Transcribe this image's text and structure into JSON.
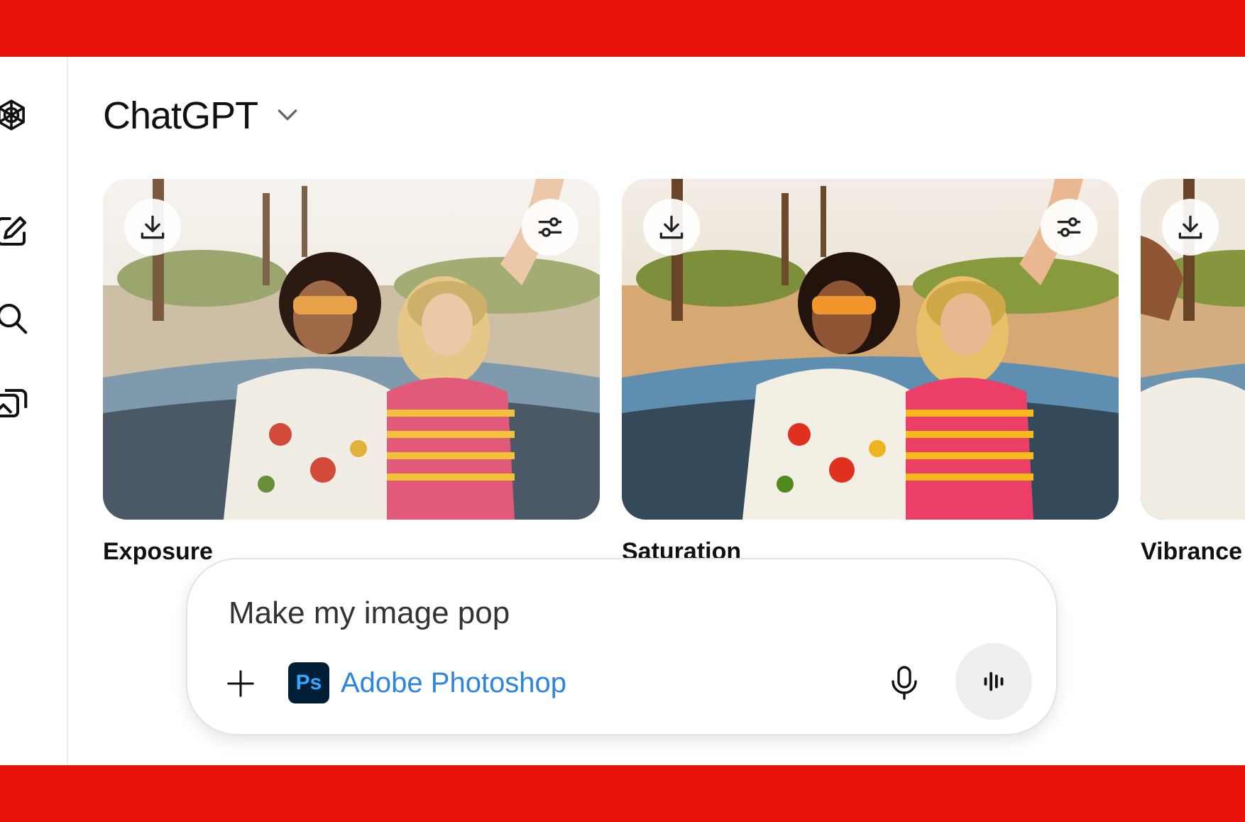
{
  "app": {
    "title": "ChatGPT",
    "accent_color": "#e8140a"
  },
  "sidebar": {
    "items": [
      {
        "name": "openai-logo-icon"
      },
      {
        "name": "new-chat-icon"
      },
      {
        "name": "search-icon"
      },
      {
        "name": "images-icon"
      }
    ]
  },
  "cards": [
    {
      "label": "Exposure",
      "download_icon": "download-icon",
      "adjust_icon": "sliders-icon"
    },
    {
      "label": "Saturation",
      "download_icon": "download-icon",
      "adjust_icon": "sliders-icon"
    },
    {
      "label": "Vibrance",
      "download_icon": "download-icon"
    }
  ],
  "composer": {
    "input_value": "Make my image pop",
    "app_chip_logo": "Ps",
    "app_chip_label": "Adobe Photoshop",
    "app_chip_color": "#2a86e0",
    "icons": [
      "plus-icon",
      "microphone-icon",
      "voice-mode-icon"
    ]
  }
}
